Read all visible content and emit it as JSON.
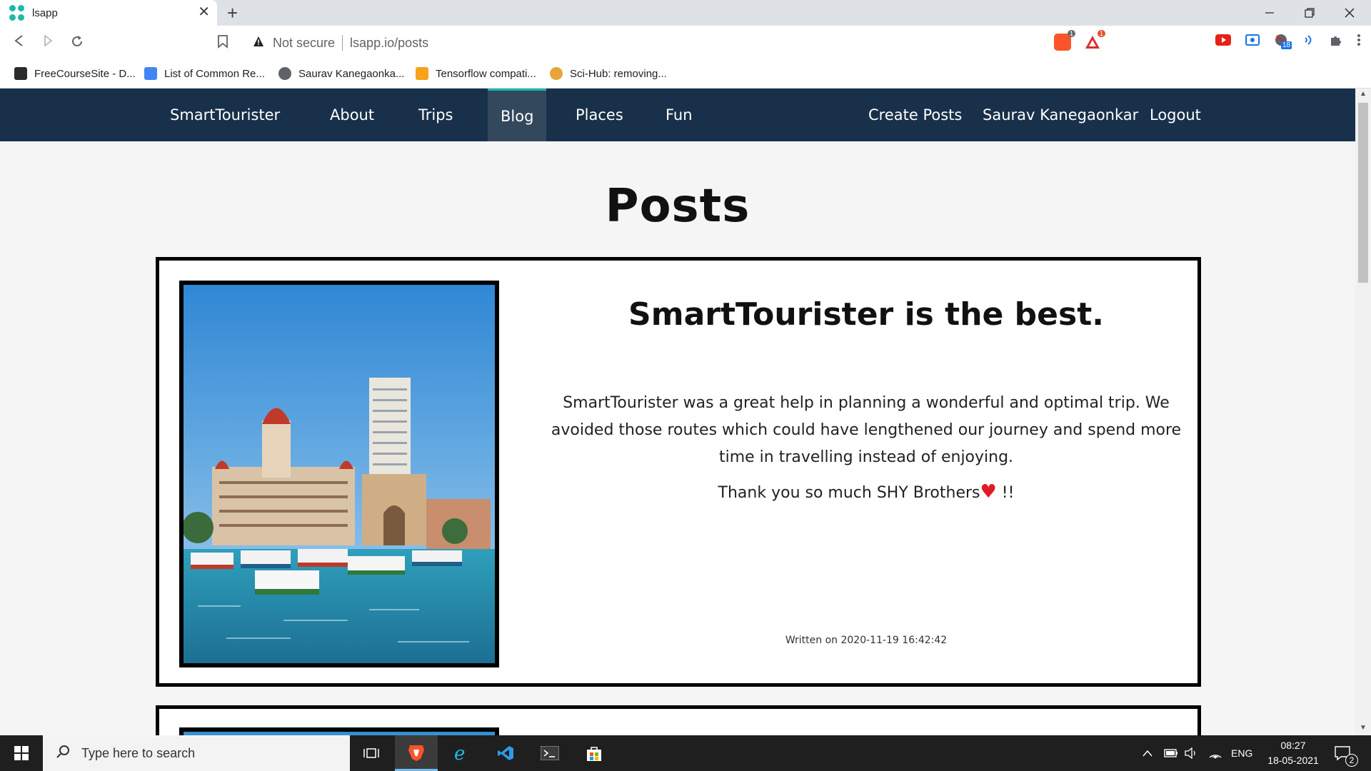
{
  "browser": {
    "tab_title": "lsapp",
    "tab_close": "✕",
    "new_tab": "+",
    "security_label": "Not secure",
    "url": "lsapp.io/posts",
    "brave_count": "1",
    "alert_count": "1",
    "ext_badge": "18",
    "bookmarks": [
      {
        "label": "FreeCourseSite - D..."
      },
      {
        "label": "List of Common Re..."
      },
      {
        "label": "Saurav Kanegaonka..."
      },
      {
        "label": "Tensorflow compati..."
      },
      {
        "label": "Sci-Hub: removing..."
      }
    ]
  },
  "navbar": {
    "brand": "SmartTourister",
    "links": [
      {
        "label": "About"
      },
      {
        "label": "Trips"
      },
      {
        "label": "Blog"
      },
      {
        "label": "Places"
      },
      {
        "label": "Fun"
      }
    ],
    "active_link": "Blog",
    "right": {
      "create": "Create Posts",
      "user": "Saurav Kanegaonkar",
      "logout": "Logout"
    }
  },
  "page": {
    "title": "Posts",
    "posts": [
      {
        "title": "SmartTourister is the best.",
        "body": "SmartTourister was a great help in planning a wonderful and optimal trip. We avoided those routes which could have lengthened our journey and spend more time in travelling instead of enjoying.",
        "thanks": "Thank you so much SHY Brothers",
        "thanks_suffix": " !!",
        "written_on": "Written on 2020-11-19 16:42:42"
      }
    ]
  },
  "taskbar": {
    "search_placeholder": "Type here to search",
    "language": "ENG",
    "time": "08:27",
    "date": "18-05-2021",
    "notifications": "2"
  },
  "colors": {
    "navbar_bg": "#18304a",
    "nav_active_bg": "#33485d",
    "nav_active_accent": "#1db8a5",
    "page_bg": "#f5f5f5"
  }
}
